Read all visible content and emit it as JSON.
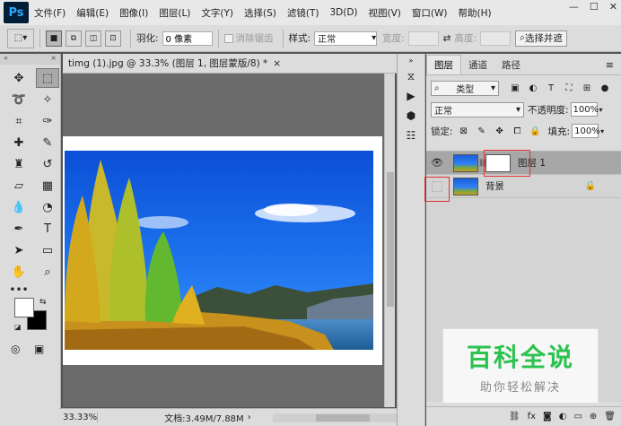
{
  "app": {
    "logo": "Ps"
  },
  "menu": [
    "文件(F)",
    "编辑(E)",
    "图像(I)",
    "图层(L)",
    "文字(Y)",
    "选择(S)",
    "滤镜(T)",
    "3D(D)",
    "视图(V)",
    "窗口(W)",
    "帮助(H)"
  ],
  "window_controls": {
    "minimize": "—",
    "restore": "☐",
    "close": "✕"
  },
  "options": {
    "feather_label": "羽化:",
    "feather_value": "0 像素",
    "antialias_label": "消除锯齿",
    "style_label": "样式:",
    "style_value": "正常",
    "width_label": "宽度:",
    "height_label": "高度:",
    "select_subject": "选择并遮"
  },
  "document": {
    "tab_title": "timg (1).jpg @ 33.3% (图层 1, 图层蒙版/8) *",
    "tab_close": "×",
    "zoom": "33.33%",
    "doc_size": "文档:3.49M/7.88M"
  },
  "layers_panel": {
    "tabs": [
      "图层",
      "通道",
      "路径"
    ],
    "filter_kind": "类型",
    "blend_mode": "正常",
    "opacity_label": "不透明度:",
    "opacity_value": "100%",
    "lock_label": "锁定:",
    "fill_label": "填充:",
    "fill_value": "100%",
    "layers": [
      {
        "name": "图层 1",
        "visible": true,
        "has_mask": true
      },
      {
        "name": "背景",
        "visible": false,
        "locked": true
      }
    ]
  },
  "watermark": {
    "main": "百科全说",
    "sub": "助你轻松解决"
  },
  "colors": {
    "accent": "#31a8ff",
    "highlight": "#e23232",
    "watermark_green": "#2cc24f"
  }
}
